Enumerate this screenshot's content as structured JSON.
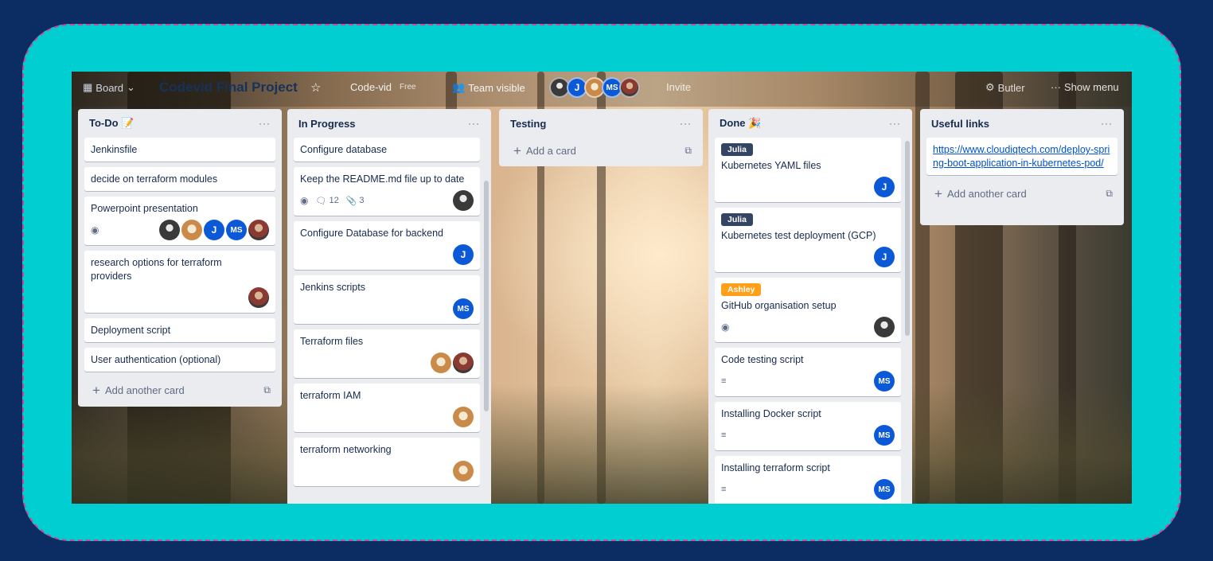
{
  "topbar": {
    "board_label": "Board",
    "title": "Codevid Final Project",
    "workspace": "Code-vid",
    "workspace_plan": "Free",
    "visibility": "Team visible",
    "invite": "Invite",
    "butler": "Butler",
    "show_menu": "Show menu",
    "members": [
      "avatar-dark",
      "J",
      "avatar-tan",
      "MS",
      "avatar-red"
    ]
  },
  "colors": {
    "frame": "#00ced1",
    "page_bg": "#0b2d63",
    "member_blue": "#0c59d8",
    "label_julia": "#344563",
    "label_ashley": "#ff9f1a"
  },
  "lists": [
    {
      "title": "To-Do 📝",
      "cards": [
        {
          "text": "Jenkinsfile"
        },
        {
          "text": "decide on terraform modules"
        },
        {
          "text": "Powerpoint presentation",
          "watch": true,
          "members": [
            "dark",
            "tan",
            "J",
            "MS",
            "red"
          ]
        },
        {
          "text": "research options for terraform providers",
          "members": [
            "red"
          ]
        },
        {
          "text": "Deployment script"
        },
        {
          "text": "User authentication (optional)"
        }
      ],
      "add_label": "Add another card"
    },
    {
      "title": "In Progress",
      "cards": [
        {
          "text": "Configure database"
        },
        {
          "text": "Keep the README.md file up to date",
          "watch": true,
          "comments": "12",
          "attachments": "3",
          "members": [
            "dark"
          ]
        },
        {
          "text": "Configure Database for backend",
          "members": [
            "J"
          ]
        },
        {
          "text": "Jenkins scripts",
          "members": [
            "MS"
          ]
        },
        {
          "text": "Terraform files",
          "members": [
            "tan",
            "red"
          ]
        },
        {
          "text": "terraform IAM",
          "members": [
            "tan"
          ]
        },
        {
          "text": "terraform networking",
          "members": [
            "tan"
          ]
        }
      ]
    },
    {
      "title": "Testing",
      "cards": [],
      "add_label": "Add a card"
    },
    {
      "title": "Done 🎉",
      "cards": [
        {
          "label": "Julia",
          "text": "Kubernetes YAML files",
          "members": [
            "J"
          ]
        },
        {
          "label": "Julia",
          "text": "Kubernetes test deployment (GCP)",
          "members": [
            "J"
          ]
        },
        {
          "label": "Ashley",
          "text": "GitHub organisation setup",
          "watch": true,
          "members": [
            "dark"
          ]
        },
        {
          "text": "Code testing script",
          "description": true,
          "members": [
            "MS"
          ]
        },
        {
          "text": "Installing Docker script",
          "description": true,
          "members": [
            "MS"
          ]
        },
        {
          "text": "Installing terraform script",
          "description": true,
          "members": [
            "MS"
          ]
        }
      ]
    },
    {
      "title": "Useful links",
      "cards": [
        {
          "link": "https://www.cloudiqtech.com/deploy-spring-boot-application-in-kubernetes-pod/"
        }
      ],
      "add_label": "Add another card"
    }
  ]
}
